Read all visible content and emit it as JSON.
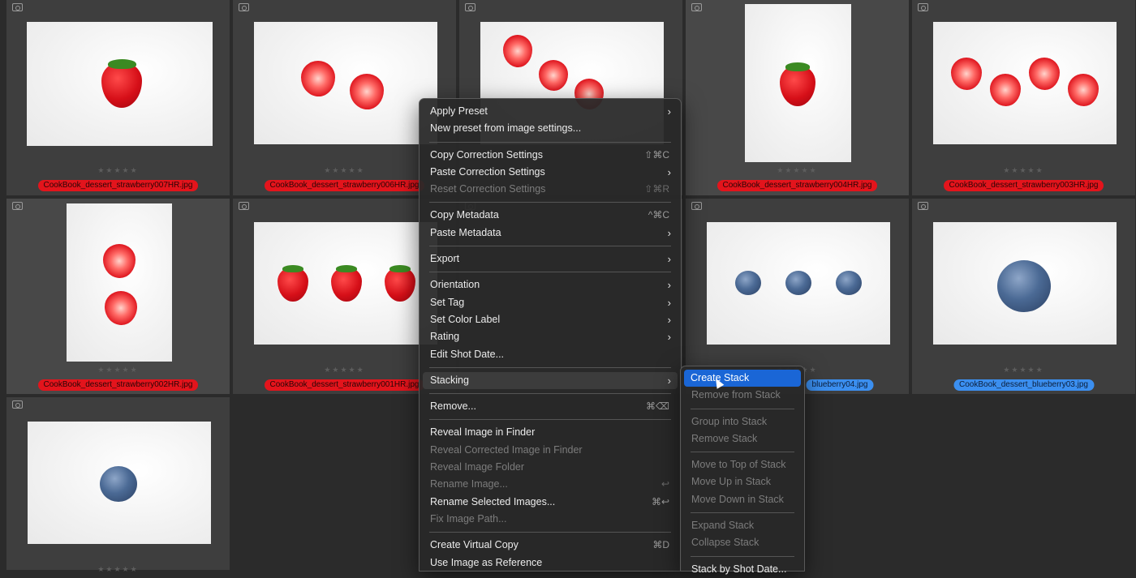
{
  "grid": {
    "rating_symbols": "★★★★★",
    "cells": [
      {
        "filename": "CookBook_dessert_strawberry007HR.jpg",
        "label_color": "red"
      },
      {
        "filename": "CookBook_dessert_strawberry006HR.jpg",
        "label_color": "red"
      },
      {
        "filename": "",
        "label_color": "none"
      },
      {
        "filename": "CookBook_dessert_strawberry004HR.jpg",
        "label_color": "red"
      },
      {
        "filename": "CookBook_dessert_strawberry003HR.jpg",
        "label_color": "red"
      },
      {
        "filename": "CookBook_dessert_strawberry002HR.jpg",
        "label_color": "red"
      },
      {
        "filename": "CookBook_dessert_strawberry001HR.jpg",
        "label_color": "red"
      },
      {
        "filename": "",
        "label_color": "none"
      },
      {
        "filename": "blueberry04.jpg",
        "label_color": "blue"
      },
      {
        "filename": "CookBook_dessert_blueberry03.jpg",
        "label_color": "blue"
      },
      {
        "filename": "",
        "label_color": "none"
      }
    ]
  },
  "context_menu": {
    "items": [
      {
        "label": "Apply Preset",
        "submenu": true
      },
      {
        "label": "New preset from image settings..."
      },
      {
        "label": "Copy Correction Settings",
        "shortcut": "⇧⌘C"
      },
      {
        "label": "Paste Correction Settings",
        "submenu": true
      },
      {
        "label": "Reset Correction Settings",
        "shortcut": "⇧⌘R",
        "disabled": true
      },
      {
        "label": "Copy Metadata",
        "shortcut": "^⌘C"
      },
      {
        "label": "Paste Metadata",
        "submenu": true
      },
      {
        "label": "Export",
        "submenu": true
      },
      {
        "label": "Orientation",
        "submenu": true
      },
      {
        "label": "Set Tag",
        "submenu": true
      },
      {
        "label": "Set Color Label",
        "submenu": true
      },
      {
        "label": "Rating",
        "submenu": true
      },
      {
        "label": "Edit Shot Date..."
      },
      {
        "label": "Stacking",
        "submenu": true,
        "highlighted": true
      },
      {
        "label": "Remove...",
        "shortcut": "⌘⌫"
      },
      {
        "label": "Reveal Image in Finder"
      },
      {
        "label": "Reveal Corrected Image in Finder",
        "disabled": true
      },
      {
        "label": "Reveal Image Folder",
        "disabled": true
      },
      {
        "label": "Rename Image...",
        "shortcut": "↩",
        "disabled": true
      },
      {
        "label": "Rename Selected Images...",
        "shortcut": "⌘↩"
      },
      {
        "label": "Fix Image Path...",
        "disabled": true
      },
      {
        "label": "Create Virtual Copy",
        "shortcut": "⌘D"
      },
      {
        "label": "Use Image as Reference"
      }
    ]
  },
  "stacking_submenu": {
    "items": [
      {
        "label": "Create Stack",
        "active": true
      },
      {
        "label": "Remove from Stack",
        "disabled": true
      },
      {
        "label": "Group into Stack",
        "disabled": true
      },
      {
        "label": "Remove Stack",
        "disabled": true
      },
      {
        "label": "Move to Top of Stack",
        "disabled": true
      },
      {
        "label": "Move Up in Stack",
        "disabled": true
      },
      {
        "label": "Move Down in Stack",
        "disabled": true
      },
      {
        "label": "Expand Stack",
        "disabled": true
      },
      {
        "label": "Collapse Stack",
        "disabled": true
      },
      {
        "label": "Stack by Shot Date..."
      }
    ]
  }
}
